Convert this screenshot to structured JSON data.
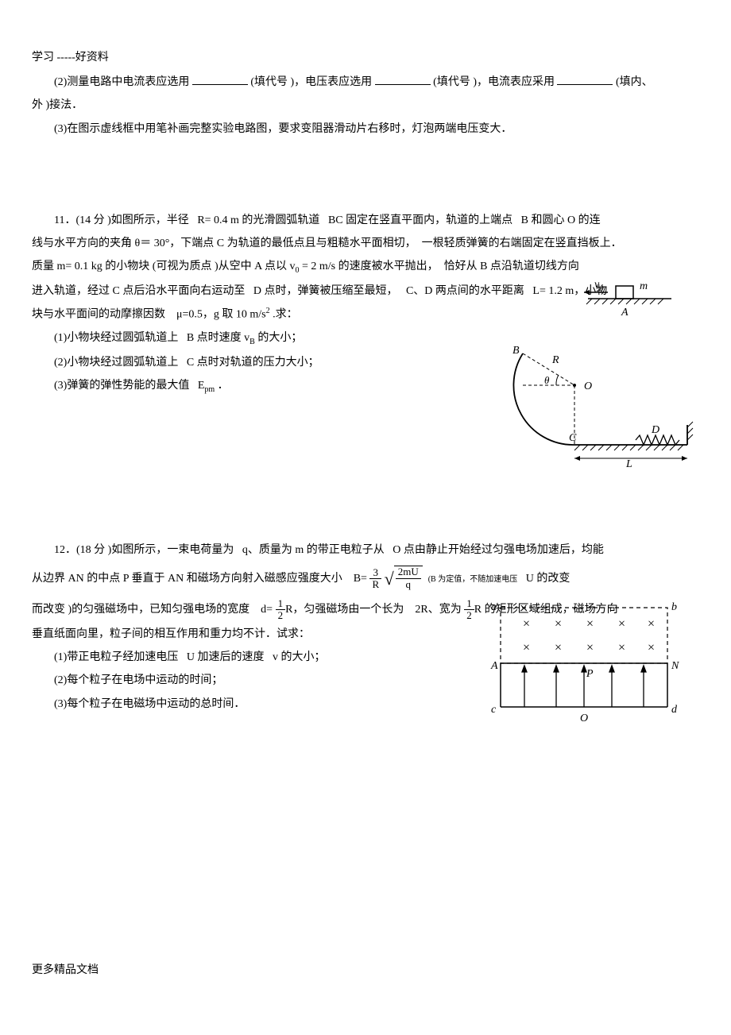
{
  "header": {
    "title": "学习 -----好资料"
  },
  "q_top": {
    "line2_a": "(2)测量电路中电流表应选用",
    "line2_b": "(填代号 )，电压表应选用",
    "line2_c": "(填代号 )，电流表应采用",
    "line2_d": "(填内、",
    "line2_e": "外 )接法．",
    "line3": "(3)在图示虚线框中用笔补画完整实验电路图，要求变阻器滑动片右移时，灯泡两端电压变大．"
  },
  "q11": {
    "l1a": "11．(14 分 )如图所示，半径",
    "l1b": "R= 0.4 m 的光滑圆弧轨道",
    "l1c": "BC 固定在竖直平面内，轨道的上端点",
    "l1d": "B 和圆心 O 的连",
    "l2a": "线与水平方向的夹角 θ＝ 30°，下端点 C 为轨道的最低点且与粗糙水平面相切，",
    "l2b": "一根轻质弹簧的右端固定在竖直挡板上．",
    "l3a": "质量 m= 0.1 kg 的小物块 (可视为质点 )从空中 A 点以 v",
    "l3b": "= 2 m/s 的速度被水平抛出，",
    "l3c": "恰好从 B 点沿轨道切线方向",
    "l4a": "进入轨道，经过 C 点后沿水平面向右运动至",
    "l4b": "D 点时，弹簧被压缩至最短，",
    "l4c": "C、D 两点间的水平距离",
    "l4d": "L= 1.2 m，小物",
    "l5a": "块与水平面间的动摩擦因数",
    "l5b": "μ=0.5，g 取 10 m/s",
    "l5c": ".求：",
    "sub1a": "(1)小物块经过圆弧轨道上",
    "sub1b": "B 点时速度 v",
    "sub1bb": "B",
    "sub1c": " 的大小；",
    "sub2a": "(2)小物块经过圆弧轨道上",
    "sub2b": "C 点时对轨道的压力大小；",
    "sub3a": "(3)弹簧的弹性势能的最大值",
    "sub3b": "E",
    "sub3bb": "pm",
    "sub3c": "．",
    "fig": {
      "v0": "v",
      "v0sub": "0",
      "m": "m",
      "A": "A",
      "B": "B",
      "R": "R",
      "theta": "θ",
      "O": "O",
      "C": "C",
      "D": "D",
      "L": "L"
    }
  },
  "q12": {
    "l1a": "12．(18 分 )如图所示，一束电荷量为",
    "l1b": "q、质量为 m 的带正电粒子从",
    "l1c": "O 点由静止开始经过匀强电场加速后，均能",
    "l2a": "从边界 AN 的中点 P 垂直于 AN 和磁场方向射入磁感应强度大小",
    "l2b": "B=",
    "l2_sqrt1": "2mU",
    "l2_q": "q",
    "l2c": "(B 为定值，不随加速电压",
    "l2d": "U 的改变",
    "l3a": "而改变 )的匀强磁场中，已知匀强电场的宽度",
    "l3b": "d=",
    "l3c": "R，匀强磁场由一个长为",
    "l3d": "2R、宽为",
    "l3e": "R 的矩形区域组成，磁场方向",
    "l4": "垂直纸面向里，粒子间的相互作用和重力均不计．试求：",
    "sub1a": "(1)带正电粒子经加速电压",
    "sub1b": "U 加速后的速度",
    "sub1c": "v 的大小；",
    "sub2": "(2)每个粒子在电场中运动的时间；",
    "sub3": "(3)每个粒子在电磁场中运动的总时间．",
    "frac3": "3",
    "fracR": "R",
    "frac1": "1",
    "frac2": "2",
    "fig": {
      "a": "a",
      "b": "b",
      "A": "A",
      "N": "N",
      "P": "P",
      "c": "c",
      "d": "d",
      "O": "O"
    }
  },
  "footer": {
    "text": "更多精品文档"
  }
}
